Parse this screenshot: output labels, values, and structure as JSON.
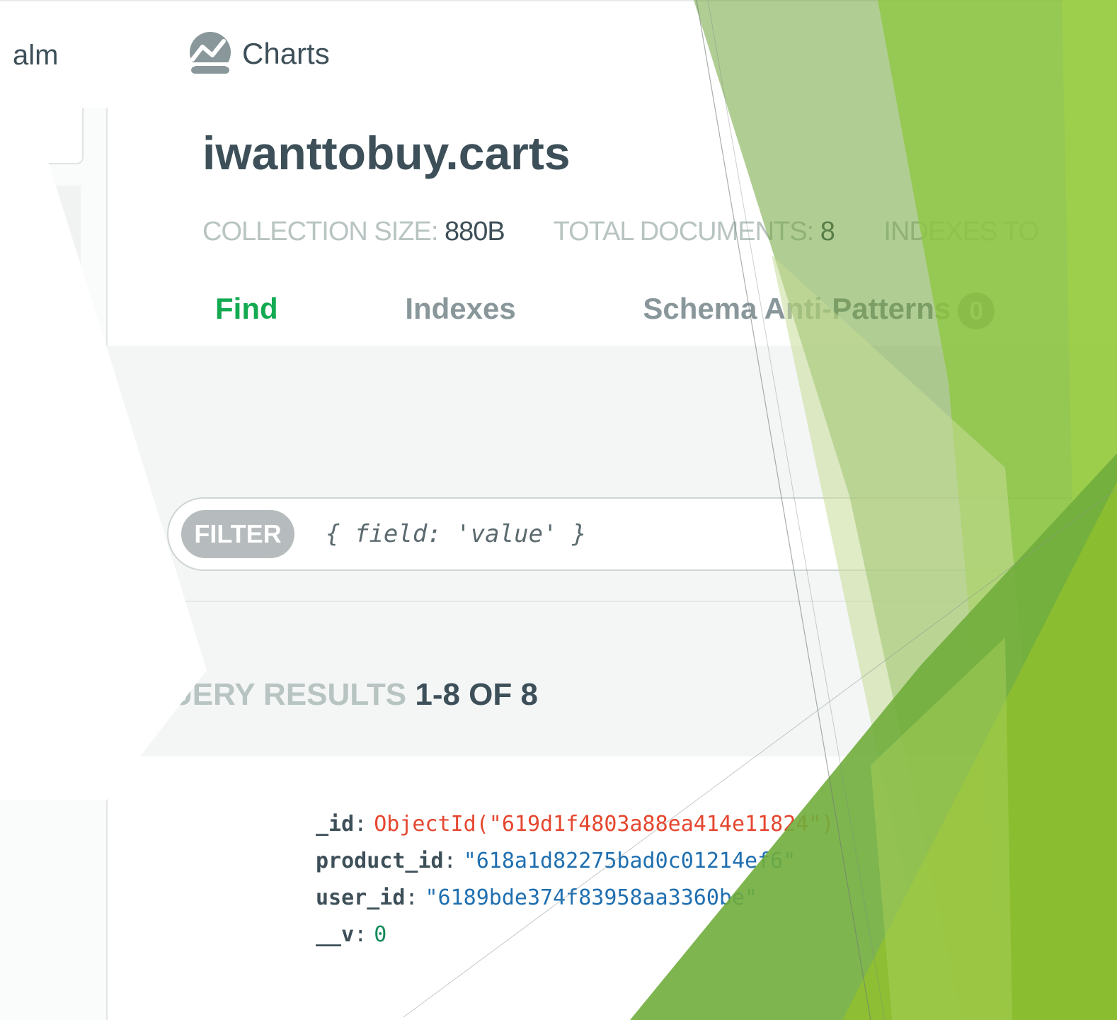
{
  "nav": {
    "partial_label": "alm",
    "charts_label": "Charts",
    "charts_icon": "chart-line-icon"
  },
  "collection": {
    "title": "iwanttobuy.carts",
    "size_label": "COLLECTION SIZE:",
    "size_value": "880B",
    "docs_label": "TOTAL DOCUMENTS:",
    "docs_value": "8",
    "indexes_label": "INDEXES TO"
  },
  "tabs": [
    {
      "label": "Find",
      "active": true
    },
    {
      "label": "Indexes",
      "active": false
    },
    {
      "label": "Schema Anti-Patterns",
      "badge": "0",
      "active": false
    }
  ],
  "filter": {
    "pill": "FILTER",
    "placeholder": "{ field: 'value' }"
  },
  "results": {
    "label": "UERY RESULTS",
    "count": "1-8 OF 8"
  },
  "document": {
    "fields": [
      {
        "key": "_id",
        "value": "ObjectId(\"619d1f4803a88ea414e11824\")",
        "type": "oid"
      },
      {
        "key": "product_id",
        "value": "\"618a1d82275bad0c01214ef6\"",
        "type": "str"
      },
      {
        "key": "user_id",
        "value": "\"6189bde374f83958aa3360be\"",
        "type": "str"
      },
      {
        "key": "__v",
        "value": "0",
        "type": "num"
      }
    ]
  },
  "colors": {
    "accent_green": "#13aa52",
    "text_dark": "#3d4f58",
    "muted": "#89979b",
    "oid_red": "#e5462f",
    "string_blue": "#1f6fb0",
    "overlay_lime": "#8dc63f"
  }
}
